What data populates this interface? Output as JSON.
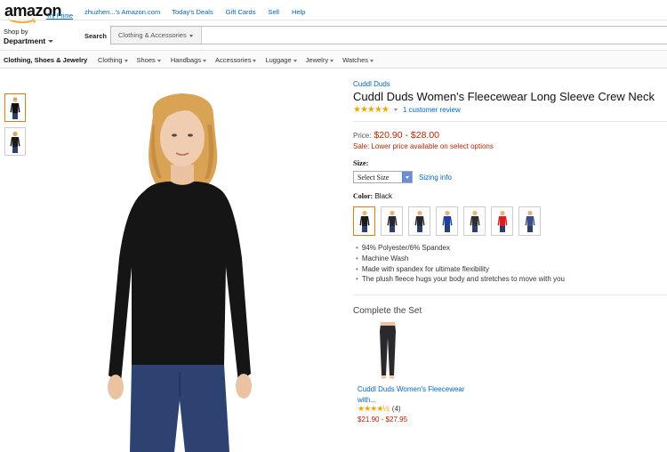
{
  "header": {
    "logo_text": "amazon",
    "try_prime": "Try Prime",
    "links": [
      "zhuzhen...'s Amazon.com",
      "Today's Deals",
      "Gift Cards",
      "Sell",
      "Help"
    ],
    "shop_by": "Shop by",
    "department": "Department",
    "search_label": "Search",
    "search_category": "Clothing & Accessories"
  },
  "category_bar": {
    "title": "Clothing, Shoes & Jewelry",
    "items": [
      "Clothing",
      "Shoes",
      "Handbags",
      "Accessories",
      "Luggage",
      "Jewelry",
      "Watches"
    ]
  },
  "product": {
    "brand": "Cuddl Duds",
    "title": "Cuddl Duds Women's Fleecewear Long Sleeve Crew Neck",
    "stars": "★★★★★",
    "review_link": "1 customer review",
    "price_label": "Price:",
    "price": "$20.90 - $28.00",
    "sale_label": "Sale:",
    "sale_text": "Lower price available on select options",
    "size_label": "Size:",
    "size_select": "Select Size",
    "sizing_info": "Sizing info",
    "color_label": "Color:",
    "color_value": "Black",
    "swatch_colors": [
      "#1a1a1a",
      "#2b2730",
      "#24262b",
      "#1f3f9e",
      "#2e2c34",
      "#d81e1e",
      "#3a4f88"
    ],
    "bullets": [
      "94% Polyester/6% Spandex",
      "Machine Wash",
      "Made with spandex for ultimate flexibility",
      "The plush fleece hugs your body and stretches to move with you"
    ]
  },
  "complete_the_set": {
    "title": "Complete the Set",
    "item_name_line1": "Cuddl Duds Women's Fleecewear",
    "item_name_line2": "with...",
    "stars": "★★★★½",
    "review_count": "(4)",
    "price": "$21.90 - $27.95"
  },
  "colors": {
    "link": "#0066c0",
    "price": "#b12704",
    "star": "#f0a500",
    "selected_border": "#e47911"
  }
}
